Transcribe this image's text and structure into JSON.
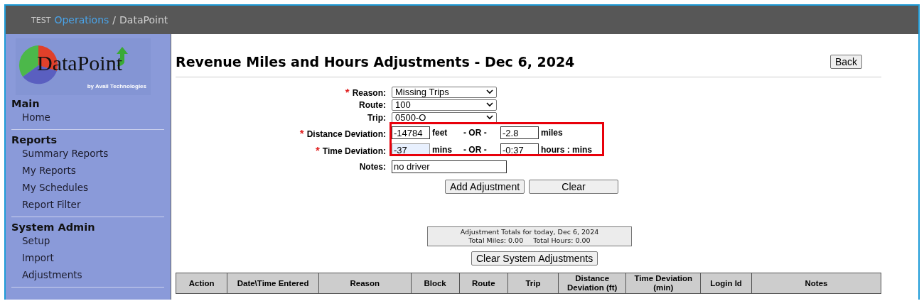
{
  "topbar": {
    "env": "TEST",
    "app": "Operations",
    "separator": "/",
    "product": "DataPoint"
  },
  "logo": {
    "name": "DataPoint",
    "tagline": "by Avail Technologies"
  },
  "sidebar": [
    {
      "heading": "Main",
      "items": [
        "Home"
      ]
    },
    {
      "heading": "Reports",
      "items": [
        "Summary Reports",
        "My Reports",
        "My Schedules",
        "Report Filter"
      ]
    },
    {
      "heading": "System Admin",
      "items": [
        "Setup",
        "Import",
        "Adjustments"
      ]
    }
  ],
  "page": {
    "title": "Revenue Miles and Hours Adjustments - Dec 6, 2024",
    "back_button": "Back"
  },
  "form": {
    "required_mark": "*",
    "rows": [
      {
        "kind": "select",
        "label": "Reason:",
        "required": true,
        "value": "Missing Trips"
      },
      {
        "kind": "select",
        "label": "Route:",
        "required": false,
        "value": "100"
      },
      {
        "kind": "select",
        "label": "Trip:",
        "required": false,
        "value": "0500-O"
      },
      {
        "kind": "deviation",
        "label": "Distance Deviation:",
        "required": true,
        "highlighted": true,
        "value": "-14784",
        "focused": false,
        "unit": "feet",
        "or": "- OR -",
        "alt_value": "-2.8",
        "alt_unit": "miles"
      },
      {
        "kind": "deviation",
        "label": "Time Deviation:",
        "required": true,
        "highlighted": true,
        "value": "-37",
        "focused": true,
        "unit": "mins",
        "or": "- OR -",
        "alt_value": "-0:37",
        "alt_unit": "hours : mins"
      },
      {
        "kind": "text",
        "label": "Notes:",
        "required": false,
        "value": "no driver"
      }
    ],
    "buttons": [
      "Add Adjustment",
      "Clear"
    ]
  },
  "totals": {
    "heading": "Adjustment Totals for today, Dec 6, 2024",
    "miles": "Total Miles: 0.00",
    "hours": "Total Hours: 0.00"
  },
  "clear_system_button": "Clear System Adjustments",
  "table": {
    "columns": [
      "Action",
      "Date\\Time Entered",
      "Reason",
      "Block",
      "Route",
      "Trip",
      "Distance Deviation (ft)",
      "Time Deviation (min)",
      "Login Id",
      "Notes"
    ]
  }
}
